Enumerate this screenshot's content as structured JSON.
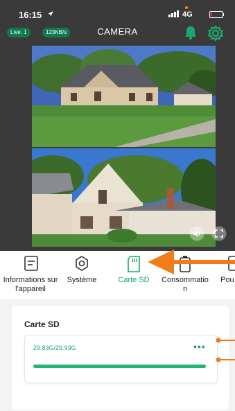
{
  "status_bar": {
    "time": "16:15",
    "network": "4G",
    "battery_level": 0.15
  },
  "header": {
    "live_badge": "Live: 1",
    "speed_badge": "123KB/s",
    "title": "CAMERA",
    "accent_color": "#1aa86b"
  },
  "tabs": [
    {
      "label": "Informations sur l'appareil",
      "icon": "device-info-icon",
      "active": false
    },
    {
      "label": "Système",
      "icon": "settings-icon",
      "active": false
    },
    {
      "label": "Carte SD",
      "icon": "sd-card-icon",
      "active": true
    },
    {
      "label": "Consommation",
      "icon": "battery-icon",
      "active": false
    },
    {
      "label": "Pou",
      "icon": "power-icon",
      "active": false
    }
  ],
  "sd_card": {
    "title": "Carte SD",
    "storage": "29.83G/29.93G",
    "usage_fraction": 0.997
  },
  "annotation_color": "#f07d1a"
}
